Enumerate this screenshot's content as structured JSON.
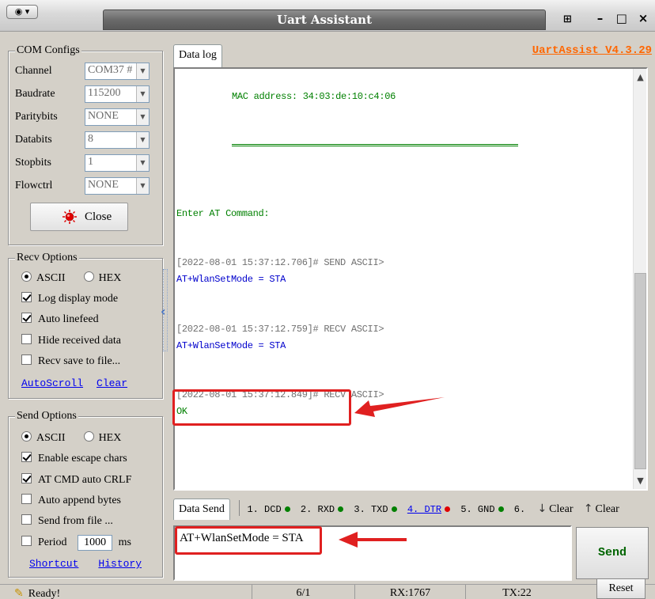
{
  "window": {
    "title": "Uart Assistant",
    "version_link": "UartAssist V4.3.29",
    "controls": {
      "pin": "⊞",
      "minimize": "–",
      "maximize": "□",
      "close": "×"
    }
  },
  "com_configs": {
    "title": "COM Configs",
    "fields": [
      {
        "label": "Channel",
        "value": "COM37 #"
      },
      {
        "label": "Baudrate",
        "value": "115200"
      },
      {
        "label": "Paritybits",
        "value": "NONE"
      },
      {
        "label": "Databits",
        "value": "8"
      },
      {
        "label": "Stopbits",
        "value": "1"
      },
      {
        "label": "Flowctrl",
        "value": "NONE"
      }
    ],
    "close_button": "Close",
    "led_color": "#e00000"
  },
  "recv_options": {
    "title": "Recv Options",
    "ascii": "ASCII",
    "hex": "HEX",
    "selected": "ASCII",
    "checks": [
      {
        "label": "Log display mode",
        "checked": true
      },
      {
        "label": "Auto linefeed",
        "checked": true
      },
      {
        "label": "Hide received data",
        "checked": false
      },
      {
        "label": "Recv save to file...",
        "checked": false
      }
    ],
    "autoscroll": "AutoScroll",
    "clear": "Clear"
  },
  "send_options": {
    "title": "Send Options",
    "ascii": "ASCII",
    "hex": "HEX",
    "selected": "ASCII",
    "checks": [
      {
        "label": "Enable escape chars",
        "checked": true
      },
      {
        "label": "AT CMD auto CRLF",
        "checked": true
      },
      {
        "label": "Auto append bytes",
        "checked": false
      },
      {
        "label": "Send from file ...",
        "checked": false
      }
    ],
    "period_label": "Period",
    "period_value": "1000",
    "period_unit": "ms",
    "shortcut": "Shortcut",
    "history": "History"
  },
  "log": {
    "tab": "Data log",
    "lines": {
      "mac": "MAC address: 34:03:de:10:c4:06",
      "prompt": "Enter AT Command:",
      "ts1": "[2022-08-01 15:37:12.706]# SEND ASCII>",
      "cmd1": "AT+WlanSetMode = STA",
      "ts2": "[2022-08-01 15:37:12.759]# RECV ASCII>",
      "cmd2": "AT+WlanSetMode = STA",
      "ts3": "[2022-08-01 15:37:12.849]# RECV ASCII>",
      "ok": "OK"
    }
  },
  "send_panel": {
    "tab": "Data Send",
    "pins": [
      {
        "label": "1. DCD",
        "color": "#008000",
        "link": false
      },
      {
        "label": "2. RXD",
        "color": "#008000",
        "link": false
      },
      {
        "label": "3. TXD",
        "color": "#008000",
        "link": false
      },
      {
        "label": "4. DTR",
        "color": "#e00000",
        "link": true
      },
      {
        "label": "5. GND",
        "color": "#008000",
        "link": false
      },
      {
        "label": "6.",
        "color": "",
        "link": false
      }
    ],
    "clear1": "Clear",
    "clear2": "Clear",
    "input_value": "AT+WlanSetMode = STA",
    "send_button": "Send"
  },
  "status": {
    "ready": "Ready!",
    "count": "6/1",
    "rx": "RX:1767",
    "tx": "TX:22",
    "reset": "Reset"
  },
  "colors": {
    "annotation_red": "#e02020",
    "log_green": "#008000",
    "log_blue": "#0000cc",
    "version_orange": "#ff6600"
  }
}
